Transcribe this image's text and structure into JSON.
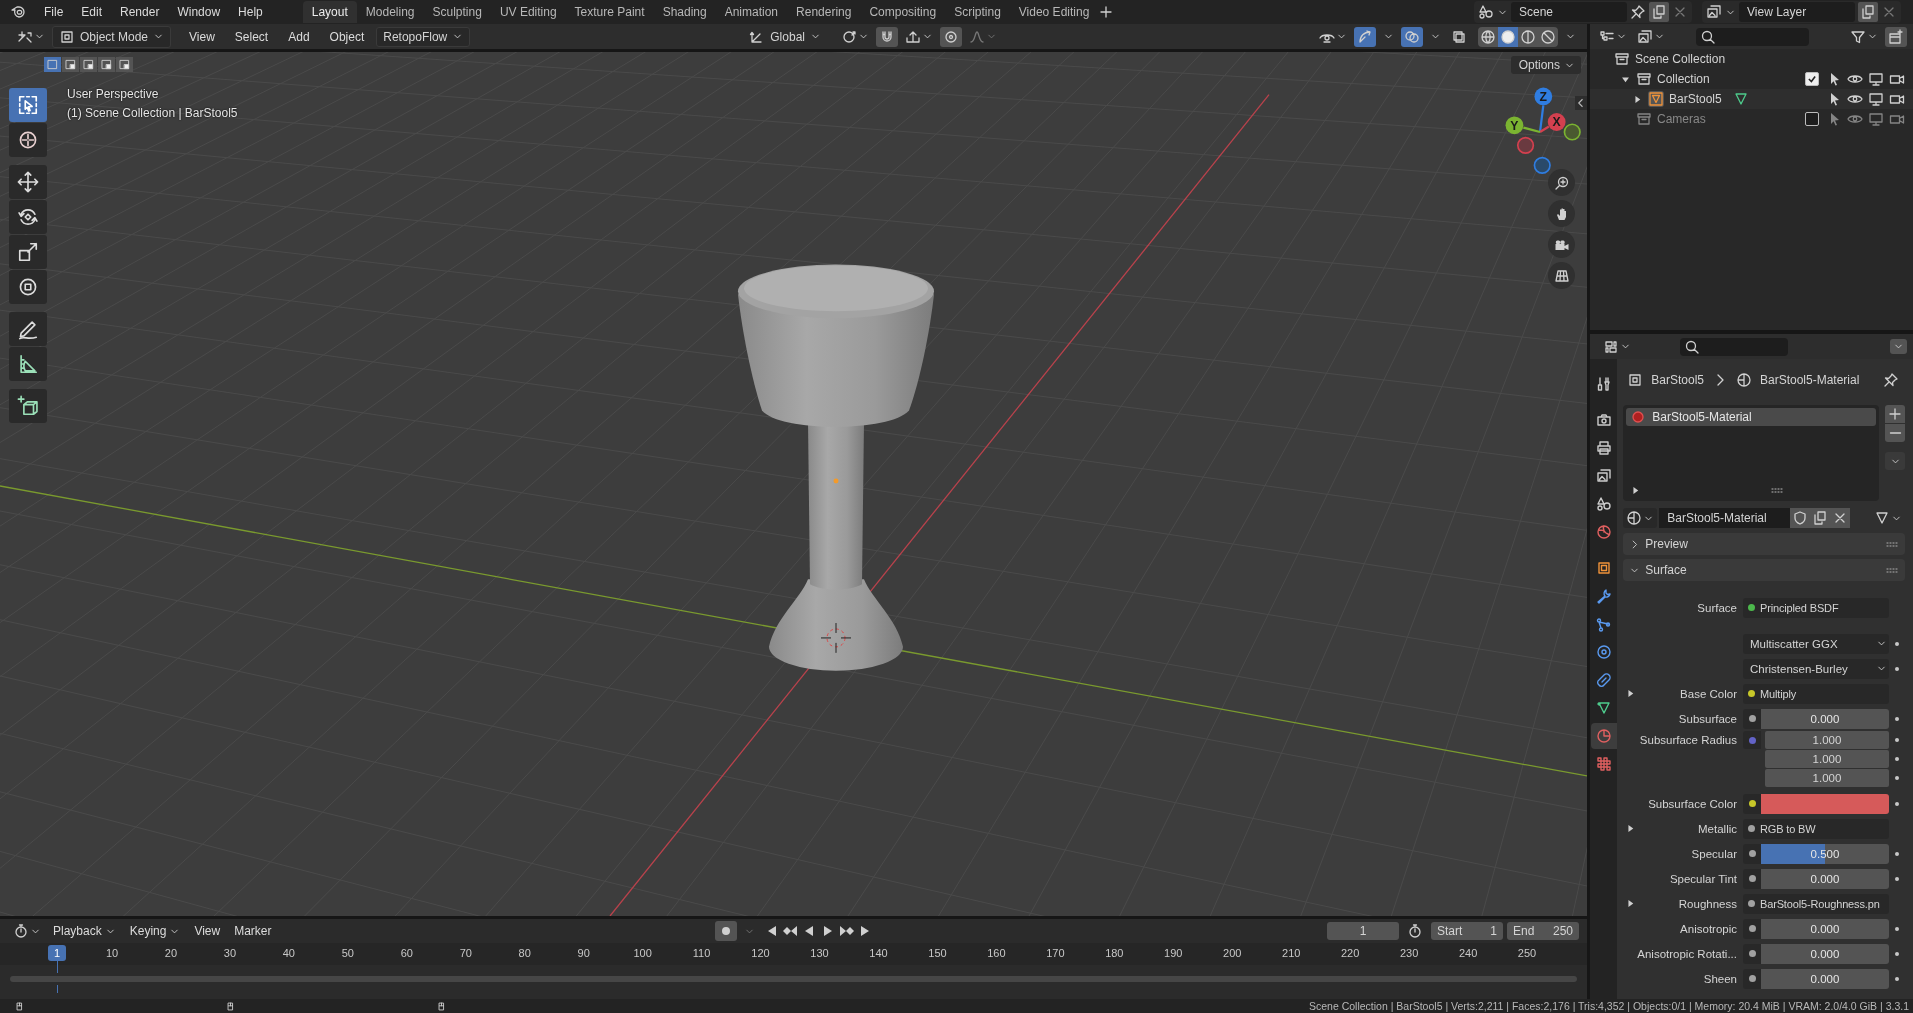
{
  "top_menu": [
    "File",
    "Edit",
    "Render",
    "Window",
    "Help"
  ],
  "workspaces": [
    {
      "label": "Layout",
      "selected": true
    },
    {
      "label": "Modeling",
      "selected": false
    },
    {
      "label": "Sculpting",
      "selected": false
    },
    {
      "label": "UV Editing",
      "selected": false
    },
    {
      "label": "Texture Paint",
      "selected": false
    },
    {
      "label": "Shading",
      "selected": false
    },
    {
      "label": "Animation",
      "selected": false
    },
    {
      "label": "Rendering",
      "selected": false
    },
    {
      "label": "Compositing",
      "selected": false
    },
    {
      "label": "Scripting",
      "selected": false
    },
    {
      "label": "Video Editing",
      "selected": false
    }
  ],
  "scene": {
    "name": "Scene"
  },
  "view_layer": {
    "name": "View Layer"
  },
  "viewport": {
    "mode": "Object Mode",
    "menus": [
      "View",
      "Select",
      "Add",
      "Object"
    ],
    "addon_menu": "RetopoFlow",
    "orientation": "Global",
    "select_modes": [
      {
        "selected": true
      },
      {
        "selected": false
      },
      {
        "selected": false
      },
      {
        "selected": false
      },
      {
        "selected": false
      }
    ],
    "gizmo_toggle": {
      "on": true
    },
    "overlay_toggle": {
      "on": true
    },
    "shading_modes": [
      {
        "kind": "wireframe",
        "selected": false
      },
      {
        "kind": "solid",
        "selected": true
      },
      {
        "kind": "material",
        "selected": false
      },
      {
        "kind": "rendered",
        "selected": false
      }
    ],
    "options": "Options",
    "info": [
      "User Perspective",
      "(1) Scene Collection | BarStool5"
    ],
    "tools": [
      {
        "kind": "select_box",
        "selected": true
      },
      {
        "kind": "cursor",
        "selected": false
      },
      {
        "kind": "move",
        "selected": false
      },
      {
        "kind": "rotate",
        "selected": false
      },
      {
        "kind": "scale",
        "selected": false
      },
      {
        "kind": "transform",
        "selected": false
      },
      {
        "kind": "annotate",
        "selected": false
      },
      {
        "kind": "measure",
        "selected": false
      },
      {
        "kind": "add_cube",
        "selected": false
      }
    ],
    "axes": [
      {
        "label": "Z",
        "color": "#2f7de1"
      },
      {
        "label": "X",
        "color": "#d4404f"
      },
      {
        "label": "Y",
        "color": "#7bb431"
      }
    ]
  },
  "outliner": {
    "root": "Scene Collection",
    "collections": [
      {
        "label": "Collection",
        "checked": true,
        "disabled": false,
        "expanded": true,
        "children": [
          {
            "label": "BarStool5",
            "expanded": false
          }
        ]
      },
      {
        "label": "Cameras",
        "checked": false,
        "disabled": true
      }
    ]
  },
  "properties": {
    "tabs": [
      {
        "kind": "tool",
        "selected": false
      },
      {
        "kind": "render",
        "selected": false
      },
      {
        "kind": "output",
        "selected": false
      },
      {
        "kind": "view_layer",
        "selected": false
      },
      {
        "kind": "scene",
        "selected": false
      },
      {
        "kind": "world",
        "selected": false
      },
      {
        "kind": "object",
        "selected": false
      },
      {
        "kind": "modifiers",
        "selected": false
      },
      {
        "kind": "particles",
        "selected": false
      },
      {
        "kind": "physics",
        "selected": false
      },
      {
        "kind": "constraints",
        "selected": false
      },
      {
        "kind": "data",
        "selected": false
      },
      {
        "kind": "material",
        "selected": true
      },
      {
        "kind": "texture",
        "selected": false
      }
    ],
    "breadcrumb": [
      "BarStool5",
      "BarStool5-Material"
    ],
    "slots": [
      {
        "label": "BarStool5-Material",
        "selected": true
      }
    ],
    "material_name": "BarStool5-Material",
    "panels": [
      {
        "label": "Preview",
        "expanded": false
      },
      {
        "label": "Surface",
        "expanded": true
      }
    ],
    "rows": [
      {
        "kind": "link",
        "label": "Surface",
        "value": "Principled BSDF",
        "socket": {
          "color": "#4cb84c"
        },
        "expandable": false
      },
      {
        "kind": "dropdown",
        "value": "Multiscatter GGX"
      },
      {
        "kind": "dropdown",
        "value": "Christensen-Burley"
      },
      {
        "kind": "link",
        "label": "Base Color",
        "value": "Multiply",
        "socket": {
          "color": "#c7c729"
        },
        "expandable": true
      },
      {
        "kind": "number",
        "label": "Subsurface",
        "value": "0.000",
        "level": 0,
        "socket": {
          "color": "#a1a1a1"
        }
      },
      {
        "kind": "vector",
        "label": "Subsurface Radius",
        "values": [
          "1.000",
          "1.000",
          "1.000"
        ],
        "socket": {
          "color": "#6363c7"
        }
      },
      {
        "kind": "color",
        "label": "Subsurface Color",
        "color": "#d65a5a",
        "socket": {
          "color": "#c7c729"
        }
      },
      {
        "kind": "link",
        "label": "Metallic",
        "value": "RGB to BW",
        "socket": {
          "color": "#a1a1a1"
        },
        "expandable": true
      },
      {
        "kind": "number",
        "label": "Specular",
        "value": "0.500",
        "level": 0.5,
        "socket": {
          "color": "#a1a1a1"
        }
      },
      {
        "kind": "number",
        "label": "Specular Tint",
        "value": "0.000",
        "level": 0,
        "socket": {
          "color": "#a1a1a1"
        }
      },
      {
        "kind": "link",
        "label": "Roughness",
        "value": "BarStool5-Roughness.pn",
        "socket": {
          "color": "#a1a1a1"
        },
        "expandable": true
      },
      {
        "kind": "number",
        "label": "Anisotropic",
        "value": "0.000",
        "level": 0,
        "socket": {
          "color": "#a1a1a1"
        }
      },
      {
        "kind": "number",
        "label": "Anisotropic Rotati...",
        "value": "0.000",
        "level": 0,
        "socket": {
          "color": "#a1a1a1"
        }
      },
      {
        "kind": "number",
        "label": "Sheen",
        "value": "0.000",
        "level": 0,
        "socket": {
          "color": "#a1a1a1"
        }
      }
    ]
  },
  "timeline": {
    "menus": [
      {
        "label": "Playback",
        "dropdown": true
      },
      {
        "label": "Keying",
        "dropdown": true
      },
      {
        "label": "View",
        "dropdown": false
      },
      {
        "label": "Marker",
        "dropdown": false
      }
    ],
    "current_frame": "1",
    "start_label": "Start",
    "start": "1",
    "end_label": "End",
    "end": "250",
    "playhead": "1",
    "ticks": [
      "10",
      "20",
      "30",
      "40",
      "50",
      "60",
      "70",
      "80",
      "90",
      "100",
      "110",
      "120",
      "130",
      "140",
      "150",
      "160",
      "170",
      "180",
      "190",
      "200",
      "210",
      "220",
      "230",
      "240",
      "250"
    ]
  },
  "status_bar": {
    "text": "Scene Collection | BarStool5 | Verts:2,211 | Faces:2,176 | Tris:4,352 | Objects:0/1 | Memory: 20.4 MiB | VRAM: 2.0/4.0 GiB | 3.3.1"
  }
}
